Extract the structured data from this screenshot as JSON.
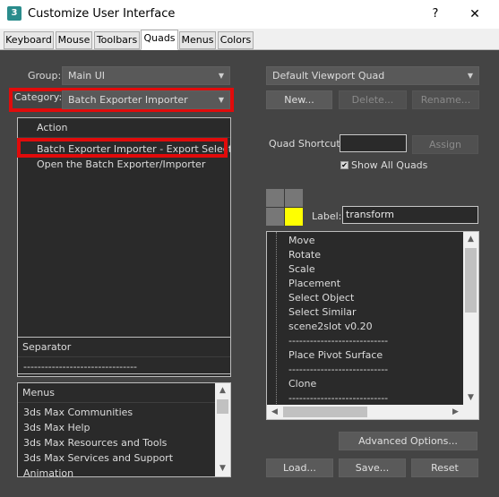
{
  "window": {
    "app_icon": "3",
    "title": "Customize User Interface",
    "help": "?",
    "close": "✕"
  },
  "tabs": [
    {
      "label": "Keyboard",
      "active": false
    },
    {
      "label": "Mouse",
      "active": false
    },
    {
      "label": "Toolbars",
      "active": false
    },
    {
      "label": "Quads",
      "active": true
    },
    {
      "label": "Menus",
      "active": false
    },
    {
      "label": "Colors",
      "active": false
    }
  ],
  "left": {
    "group_label": "Group:",
    "group_value": "Main UI",
    "category_label": "Category:",
    "category_value": "Batch Exporter Importer",
    "action_header": "Action",
    "actions": [
      "Batch Exporter Importer - Export Selected",
      "Open the Batch Exporter/Importer"
    ],
    "separator_header": "Separator",
    "separator_item": "--------------------------------",
    "menus_header": "Menus",
    "menus": [
      "3ds Max Communities",
      "3ds Max Help",
      "3ds Max Resources and Tools",
      "3ds Max Services and Support",
      "Animation"
    ]
  },
  "right": {
    "quad_menu_value": "Default Viewport Quad",
    "new_button": "New...",
    "delete_button": "Delete...",
    "rename_button": "Rename...",
    "quad_shortcut_label": "Quad Shortcut:",
    "quad_shortcut_value": "",
    "assign_button": "Assign",
    "show_all_quads_label": "Show All Quads",
    "show_all_quads_checked": true,
    "label_label": "Label:",
    "label_value": "transform",
    "quad_items": [
      "Move",
      "Rotate",
      "Scale",
      "Placement",
      "Select Object",
      "Select Similar",
      "scene2slot v0.20",
      "----------------------------",
      "Place Pivot Surface",
      "----------------------------",
      "Clone",
      "----------------------------"
    ],
    "advanced_options_button": "Advanced Options...",
    "load_button": "Load...",
    "save_button": "Save...",
    "reset_button": "Reset"
  },
  "colors": {
    "highlight": "#e10b0b",
    "quad_active": "#ffff00",
    "quad_inactive": "#777777"
  },
  "icons": [
    "app-icon",
    "help-icon",
    "close-icon",
    "dropdown-arrow-icon",
    "checkbox-icon",
    "scroll-up-icon",
    "scroll-down-icon",
    "scroll-left-icon",
    "scroll-right-icon"
  ]
}
